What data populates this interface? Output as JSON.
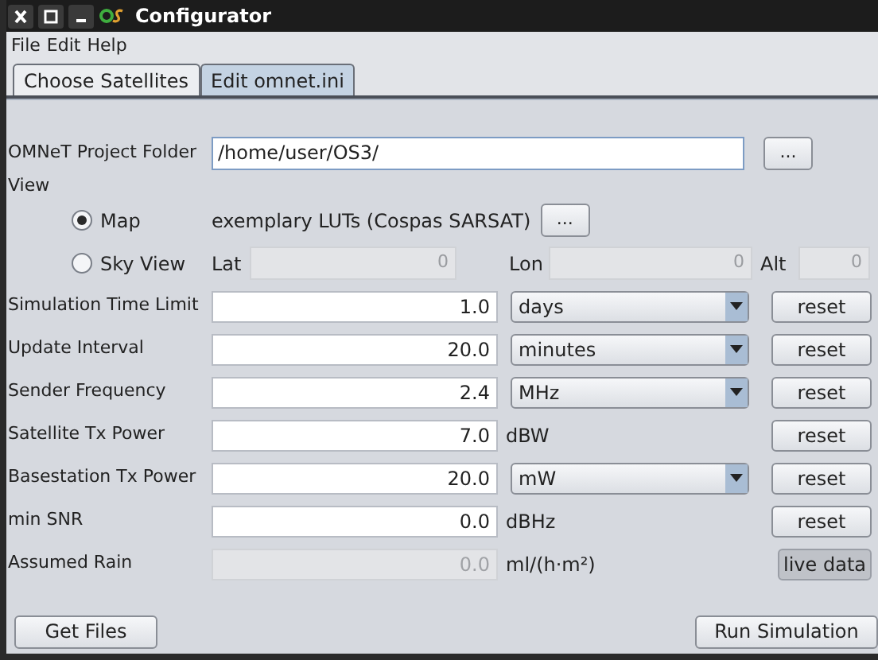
{
  "window": {
    "title": "Configurator"
  },
  "menu": [
    "File",
    "Edit",
    "Help"
  ],
  "tabs": [
    {
      "label": "Choose Satellites",
      "selected": false
    },
    {
      "label": "Edit omnet.ini",
      "selected": true
    }
  ],
  "project_folder": {
    "label": "OMNeT Project Folder",
    "value": "/home/user/OS3/",
    "button": "..."
  },
  "view": {
    "label": "View",
    "options": [
      {
        "kind": "map",
        "label": "Map",
        "selected": true,
        "text": "exemplary LUTs (Cospas SARSAT)",
        "button": "..."
      },
      {
        "kind": "sky",
        "label": "Sky View",
        "selected": false,
        "coords": [
          {
            "label": "Lat",
            "value": "0",
            "disabled": true
          },
          {
            "label": "Lon",
            "value": "0",
            "disabled": true
          },
          {
            "label": "Alt",
            "value": "0",
            "disabled": true
          }
        ]
      }
    ]
  },
  "parameters": [
    {
      "label": "Simulation Time Limit",
      "value": "1.0",
      "kind": "dropdown",
      "unit": "days",
      "disabled": false,
      "action": {
        "label": "reset",
        "pressed": false
      }
    },
    {
      "label": "Update Interval",
      "value": "20.0",
      "kind": "dropdown",
      "unit": "minutes",
      "disabled": false,
      "action": {
        "label": "reset",
        "pressed": false
      }
    },
    {
      "label": "Sender Frequency",
      "value": "2.4",
      "kind": "dropdown",
      "unit": "MHz",
      "disabled": false,
      "action": {
        "label": "reset",
        "pressed": false
      }
    },
    {
      "label": "Satellite Tx Power",
      "value": "7.0",
      "kind": "unit",
      "unit": "dBW",
      "disabled": false,
      "action": {
        "label": "reset",
        "pressed": false
      }
    },
    {
      "label": "Basestation Tx Power",
      "value": "20.0",
      "kind": "dropdown",
      "unit": "mW",
      "disabled": false,
      "action": {
        "label": "reset",
        "pressed": false
      }
    },
    {
      "label": "min SNR",
      "value": "0.0",
      "kind": "unit",
      "unit": "dBHz",
      "disabled": false,
      "action": {
        "label": "reset",
        "pressed": false
      }
    },
    {
      "label": "Assumed Rain",
      "value": "0.0",
      "kind": "unit",
      "unit": "ml/(h·m²)",
      "disabled": true,
      "action": {
        "label": "live data",
        "pressed": true
      }
    }
  ],
  "buttons": [
    {
      "label": "Get Files"
    },
    {
      "label": "Run Simulation"
    }
  ]
}
